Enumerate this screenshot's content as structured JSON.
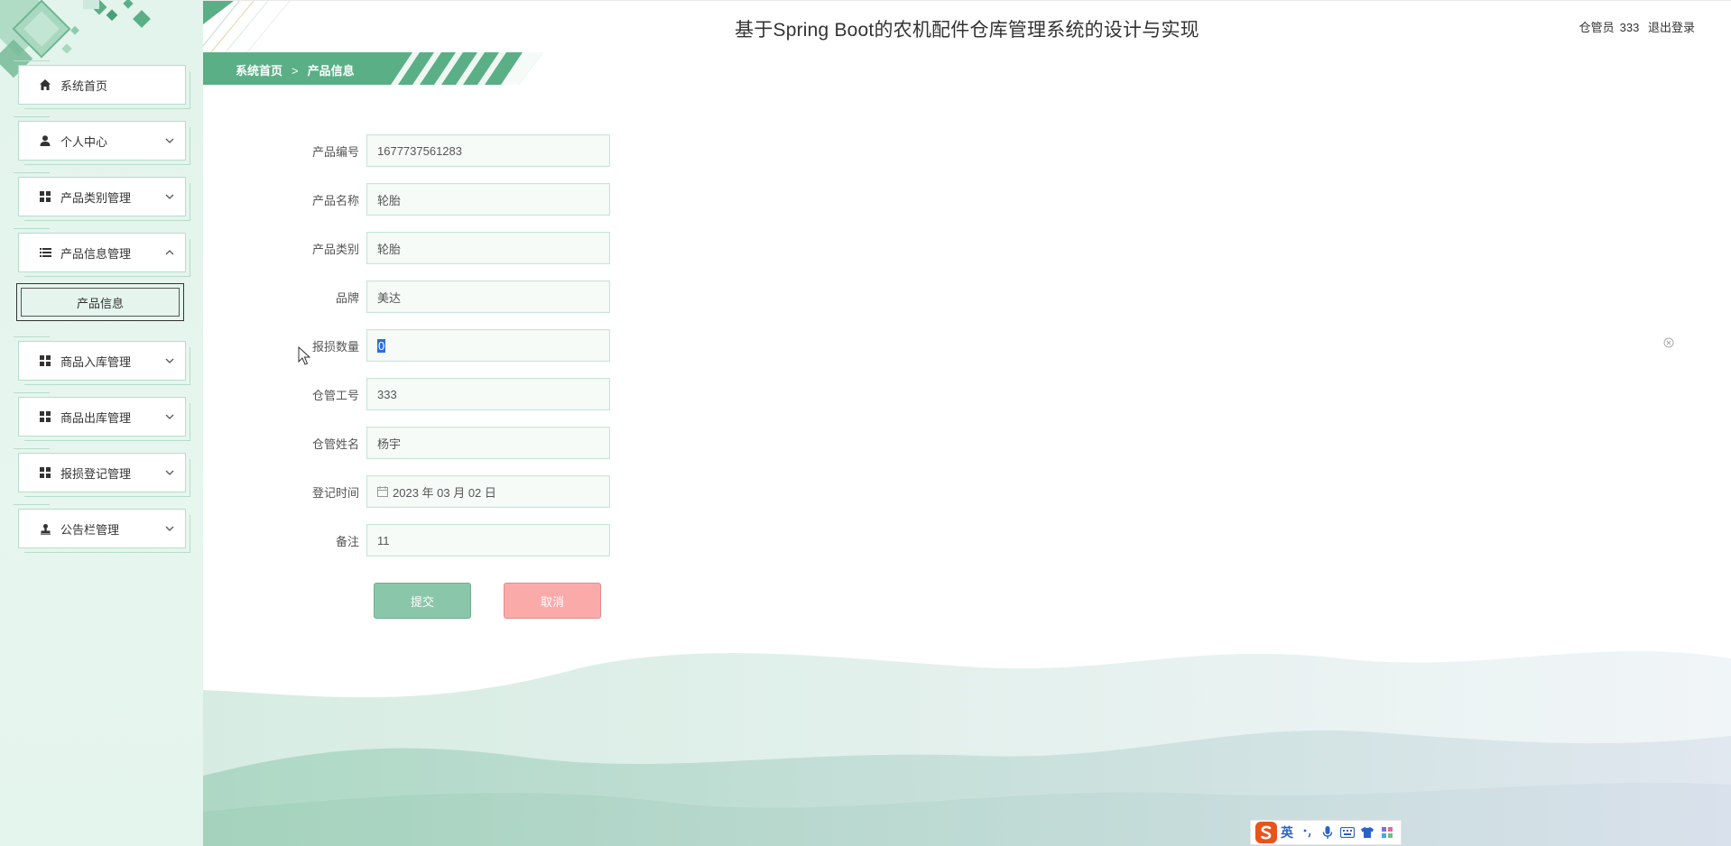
{
  "header": {
    "title": "基于Spring Boot的农机配件仓库管理系统的设计与实现",
    "user_role": "仓管员",
    "user_name": "333",
    "logout_label": "退出登录"
  },
  "breadcrumb": {
    "home": "系统首页",
    "separator": ">",
    "current": "产品信息"
  },
  "sidebar": {
    "items": [
      {
        "label": "系统首页",
        "icon": "home-icon"
      },
      {
        "label": "个人中心",
        "icon": "user-icon"
      },
      {
        "label": "产品类别管理",
        "icon": "grid-icon"
      },
      {
        "label": "产品信息管理",
        "icon": "list-icon"
      },
      {
        "label": "商品入库管理",
        "icon": "grid-icon"
      },
      {
        "label": "商品出库管理",
        "icon": "grid-icon"
      },
      {
        "label": "报损登记管理",
        "icon": "grid-icon"
      },
      {
        "label": "公告栏管理",
        "icon": "stamp-icon"
      }
    ],
    "submenu": {
      "label": "产品信息"
    }
  },
  "form": {
    "fields": [
      {
        "label": "产品编号",
        "value": "1677737561283"
      },
      {
        "label": "产品名称",
        "value": "轮胎"
      },
      {
        "label": "产品类别",
        "value": "轮胎"
      },
      {
        "label": "品牌",
        "value": "美达"
      },
      {
        "label": "报损数量",
        "value": "0"
      },
      {
        "label": "仓管工号",
        "value": "333"
      },
      {
        "label": "仓管姓名",
        "value": "杨宇"
      },
      {
        "label": "登记时间",
        "value": "2023 年 03 月 02 日"
      },
      {
        "label": "备注",
        "value": "11"
      }
    ],
    "submit_label": "提交",
    "cancel_label": "取消"
  },
  "ime": {
    "lang": "英"
  },
  "colors": {
    "primary": "#5aaf86",
    "sidebar_bg": "#e4f5ed",
    "submit_bg": "#8ac6aa",
    "cancel_bg": "#fbaaaa",
    "selection": "#2b6fd6"
  }
}
